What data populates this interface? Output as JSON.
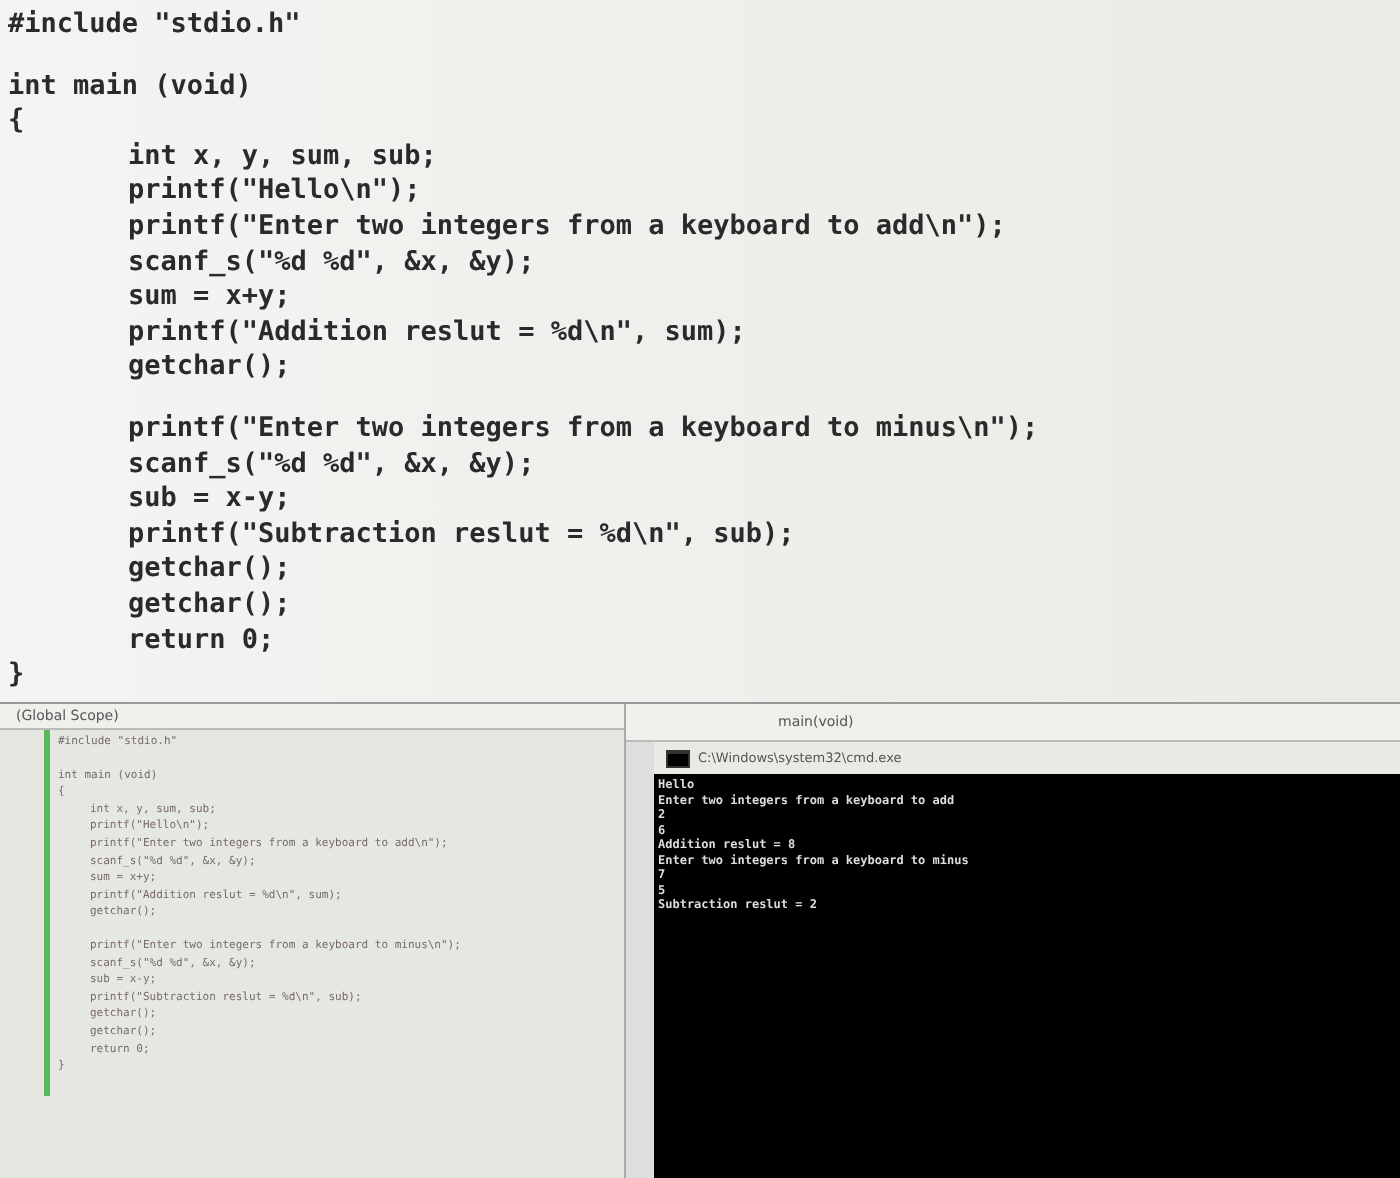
{
  "editor": {
    "blocks": [
      [
        {
          "text": "#include \"stdio.h\"",
          "indented": false
        }
      ],
      [
        {
          "text": "int main (void)",
          "indented": false
        },
        {
          "text": "{",
          "indented": false
        },
        {
          "text": "int x, y, sum, sub;",
          "indented": true
        },
        {
          "text": "printf(\"Hello\\n\");",
          "indented": true
        },
        {
          "text": "printf(\"Enter two integers from a keyboard to add\\n\");",
          "indented": true
        },
        {
          "text": "scanf_s(\"%d %d\", &x, &y);",
          "indented": true
        },
        {
          "text": "sum = x+y;",
          "indented": true
        },
        {
          "text": "printf(\"Addition reslut = %d\\n\", sum);",
          "indented": true
        },
        {
          "text": "getchar();",
          "indented": true
        }
      ],
      [
        {
          "text": "printf(\"Enter two integers from a keyboard to minus\\n\");",
          "indented": true
        },
        {
          "text": "scanf_s(\"%d %d\", &x, &y);",
          "indented": true
        },
        {
          "text": "sub = x-y;",
          "indented": true
        },
        {
          "text": "printf(\"Subtraction reslut = %d\\n\", sub);",
          "indented": true
        },
        {
          "text": "getchar();",
          "indented": true
        },
        {
          "text": "getchar();",
          "indented": true
        },
        {
          "text": "return 0;",
          "indented": true
        },
        {
          "text": "}",
          "indented": false
        }
      ]
    ]
  },
  "ide": {
    "scope": "(Global Scope)",
    "function": "main(void)",
    "blocks": [
      [
        {
          "text": "#include \"stdio.h\"",
          "indented": false
        }
      ],
      [
        {
          "text": "int main (void)",
          "indented": false
        },
        {
          "text": "{",
          "indented": false
        },
        {
          "text": "int x, y, sum, sub;",
          "indented": true
        },
        {
          "text": "printf(\"Hello\\n\");",
          "indented": true
        },
        {
          "text": "printf(\"Enter two integers from a keyboard to add\\n\");",
          "indented": true
        },
        {
          "text": "scanf_s(\"%d %d\", &x, &y);",
          "indented": true
        },
        {
          "text": "sum = x+y;",
          "indented": true
        },
        {
          "text": "printf(\"Addition reslut = %d\\n\", sum);",
          "indented": true
        },
        {
          "text": "getchar();",
          "indented": true
        }
      ],
      [
        {
          "text": "printf(\"Enter two integers from a keyboard to minus\\n\");",
          "indented": true
        },
        {
          "text": "scanf_s(\"%d %d\", &x, &y);",
          "indented": true
        },
        {
          "text": "sub = x-y;",
          "indented": true
        },
        {
          "text": "printf(\"Subtraction reslut = %d\\n\", sub);",
          "indented": true
        },
        {
          "text": "getchar();",
          "indented": true
        },
        {
          "text": "getchar();",
          "indented": true
        },
        {
          "text": "return 0;",
          "indented": true
        },
        {
          "text": "}",
          "indented": false
        }
      ]
    ]
  },
  "console": {
    "title": "C:\\Windows\\system32\\cmd.exe",
    "lines": [
      "Hello",
      "Enter two integers from a keyboard to add",
      "2",
      "6",
      "Addition reslut = 8",
      "Enter two integers from a keyboard to minus",
      "7",
      "5",
      "Subtraction reslut = 2"
    ]
  }
}
